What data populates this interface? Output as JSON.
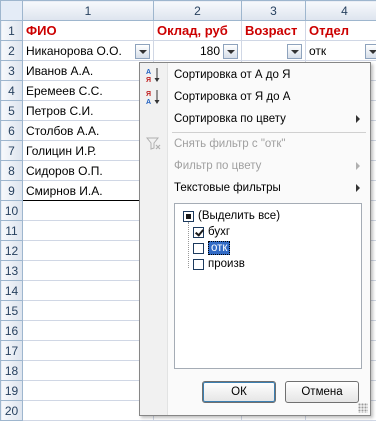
{
  "columns": [
    "1",
    "2",
    "3",
    "4"
  ],
  "rows": [
    "1",
    "2",
    "3",
    "4",
    "5",
    "6",
    "7",
    "8",
    "9",
    "10",
    "11",
    "12",
    "13",
    "14",
    "15",
    "16",
    "17",
    "18",
    "19",
    "20"
  ],
  "header_row": {
    "fio": "ФИО",
    "salary": "Оклад, руб",
    "age": "Возраст",
    "dept": "Отдел"
  },
  "data_row2": {
    "name": "Никанорова О.О.",
    "salary": "180",
    "age": "",
    "dept": "отк"
  },
  "names": [
    "Иванов А.А.",
    "Еремеев С.С.",
    "Петров С.И.",
    "Столбов А.А.",
    "Голицин И.Р.",
    "Сидоров О.П.",
    "Смирнов И.А."
  ],
  "menu": {
    "sort_asc": "Сортировка от А до Я",
    "sort_desc": "Сортировка от Я до А",
    "sort_color": "Сортировка по цвету",
    "clear_filter": "Снять фильтр с \"отк\"",
    "filter_color": "Фильтр по цвету",
    "text_filters": "Текстовые фильтры"
  },
  "filter_list": {
    "select_all": "(Выделить все)",
    "items": [
      {
        "label": "бухг",
        "checked": true
      },
      {
        "label": "отк",
        "checked": false
      },
      {
        "label": "произв",
        "checked": false
      }
    ]
  },
  "buttons": {
    "ok": "ОК",
    "cancel": "Отмена"
  },
  "colors": {
    "header_text": "#cc0000",
    "selection": "#316ac5"
  }
}
